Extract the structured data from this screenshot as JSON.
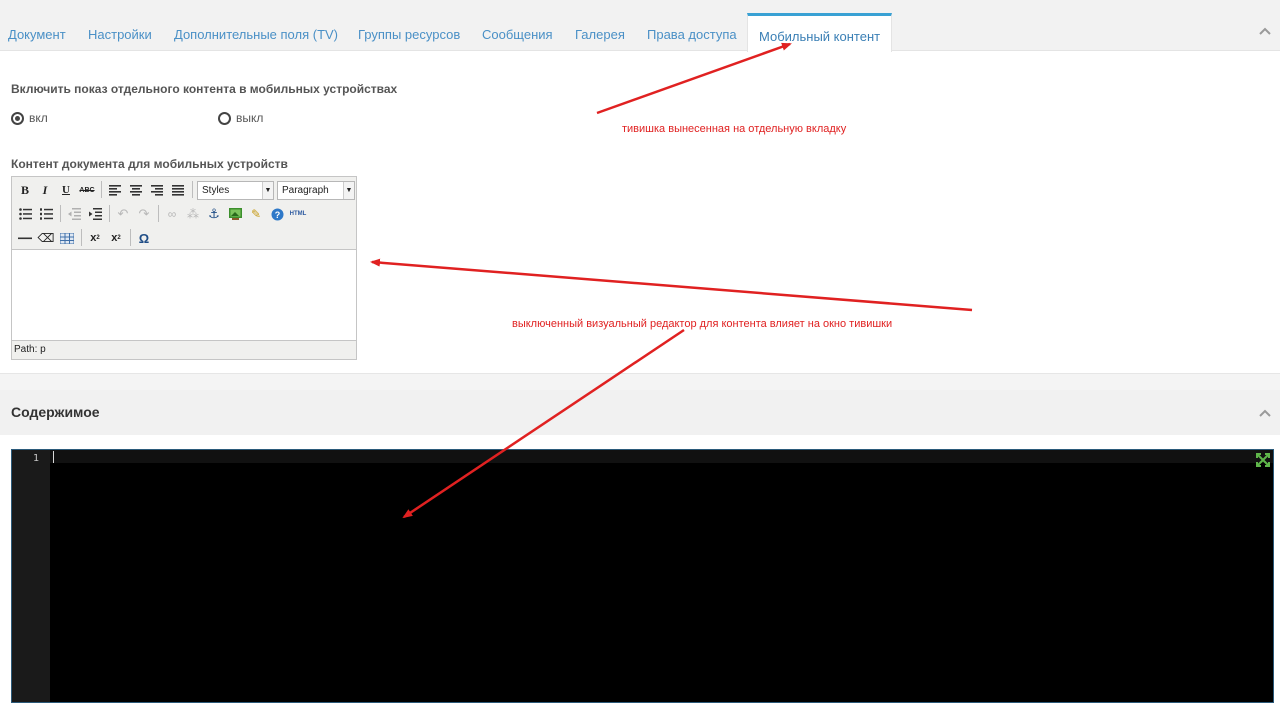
{
  "tabs": [
    {
      "label": "Документ"
    },
    {
      "label": "Настройки"
    },
    {
      "label": "Дополнительные поля (TV)"
    },
    {
      "label": "Группы ресурсов"
    },
    {
      "label": "Сообщения"
    },
    {
      "label": "Галерея"
    },
    {
      "label": "Права доступа"
    },
    {
      "label": "Мобильный контент",
      "active": true
    }
  ],
  "mobile": {
    "enable_label": "Включить показ отдельного контента в мобильных устройствах",
    "radio_on": "вкл",
    "radio_off": "выкл",
    "selected": "вкл",
    "content_label": "Контент документа для мобильных устройств"
  },
  "editor": {
    "styles_select": "Styles",
    "format_select": "Paragraph",
    "path_text": "Path: p",
    "buttons": [
      "bold",
      "italic",
      "underline",
      "strikethrough",
      "align-left",
      "align-center",
      "align-right",
      "align-justify",
      "bullet-list",
      "numbered-list",
      "outdent",
      "indent",
      "undo",
      "redo",
      "link",
      "unlink",
      "anchor",
      "image",
      "cleanup",
      "help",
      "html",
      "horizontal-rule",
      "remove-format",
      "visual-aid",
      "subscript",
      "superscript",
      "special-char"
    ]
  },
  "content_section": {
    "title": "Содержимое",
    "line_number": "1"
  },
  "annotations": {
    "note_tab": "тивишка вынесенная на отдельную вкладку",
    "note_editor": "выключенный визуальный редактор для контента влияет на окно тивишки"
  },
  "colors": {
    "tab_link": "#4a90c6",
    "tab_active_border": "#39a1d4",
    "annotation": "#e02121",
    "code_bg": "#000000"
  }
}
